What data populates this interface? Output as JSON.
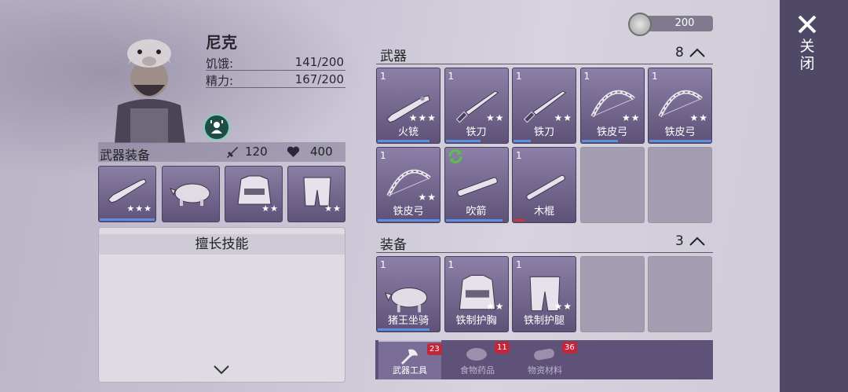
{
  "character": {
    "name": "尼克",
    "stats": [
      {
        "label": "饥饿:",
        "value": "141/200"
      },
      {
        "label": "精力:",
        "value": "167/200"
      }
    ]
  },
  "equipment_bar": {
    "title": "武器装备",
    "attack": "120",
    "health": "400"
  },
  "equipped": [
    {
      "icon": "musket-icon",
      "stars": "★★★"
    },
    {
      "icon": "boar-mount-icon",
      "stars": ""
    },
    {
      "icon": "chest-armor-icon",
      "stars": "★★"
    },
    {
      "icon": "leg-armor-icon",
      "stars": "★★"
    }
  ],
  "skills": {
    "title": "擅长技能"
  },
  "currency": {
    "amount": "200"
  },
  "weapons_section": {
    "title": "武器",
    "count": "8",
    "items": [
      {
        "qty": "1",
        "name": "火铳",
        "stars": "★★★",
        "icon": "musket-icon",
        "durability": 0.82
      },
      {
        "qty": "1",
        "name": "铁刀",
        "stars": "★★",
        "icon": "iron-knife-icon",
        "durability": 0.55
      },
      {
        "qty": "1",
        "name": "铁刀",
        "stars": "★★",
        "icon": "iron-knife-icon",
        "durability": 0.28
      },
      {
        "qty": "1",
        "name": "铁皮弓",
        "stars": "★★",
        "icon": "iron-bow-icon",
        "durability": 0.58
      },
      {
        "qty": "1",
        "name": "铁皮弓",
        "stars": "★★",
        "icon": "iron-bow-icon",
        "durability": 1.0
      },
      {
        "qty": "1",
        "name": "铁皮弓",
        "stars": "★★",
        "icon": "iron-bow-icon",
        "durability": 1.0
      },
      {
        "qty": "",
        "name": "吹箭",
        "stars": "",
        "icon": "blowgun-icon",
        "durability": 0.9
      },
      {
        "qty": "1",
        "name": "木棍",
        "stars": "",
        "icon": "wooden-stick-icon",
        "durability": 0.18
      }
    ]
  },
  "gear_section": {
    "title": "装备",
    "count": "3",
    "items": [
      {
        "qty": "1",
        "name": "猪王坐骑",
        "stars": "",
        "icon": "boar-mount-icon",
        "durability": 0.82
      },
      {
        "qty": "1",
        "name": "铁制护胸",
        "stars": "★★",
        "icon": "chest-armor-icon",
        "durability": 0.0
      },
      {
        "qty": "1",
        "name": "铁制护腿",
        "stars": "★★",
        "icon": "leg-armor-icon",
        "durability": 0.0
      }
    ]
  },
  "tabs": [
    {
      "label": "武器工具",
      "badge": "23",
      "icon": "axe-icon",
      "active": true
    },
    {
      "label": "食物药品",
      "badge": "11",
      "icon": "meat-icon",
      "active": false
    },
    {
      "label": "物资材料",
      "badge": "36",
      "icon": "log-icon",
      "active": false
    }
  ],
  "close": {
    "label": "关闭"
  },
  "colors": {
    "accent_blue": "#5b8fe0",
    "durability_red": "#d0323c",
    "badge_red": "#c4253a",
    "panel_purple": "#5f5279"
  }
}
